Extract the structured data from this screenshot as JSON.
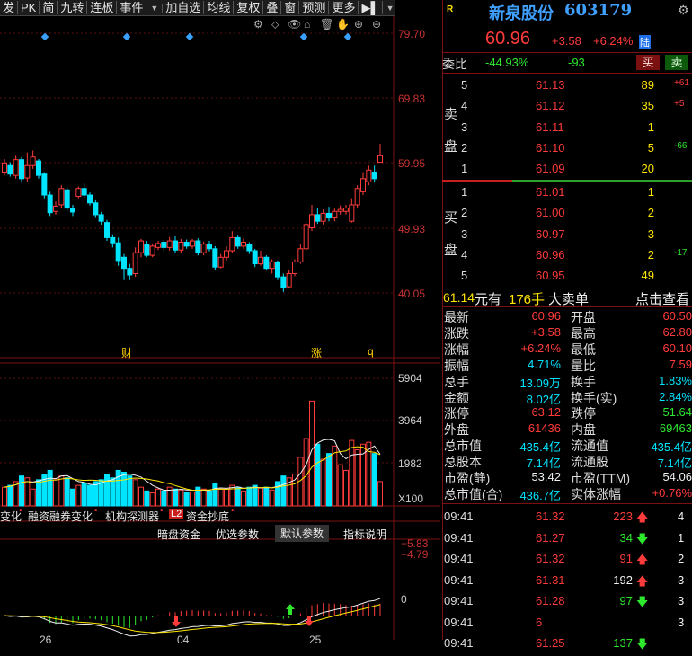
{
  "toolbar": {
    "items": [
      "发",
      "PK",
      "简",
      "九转",
      "连板",
      "事件",
      "▼",
      "加自选",
      "均线",
      "复权",
      "叠",
      "窗",
      "预测",
      "更多",
      "▶▌",
      "▼"
    ]
  },
  "chart": {
    "price_axis": [
      "79.70",
      "69.83",
      "59.95",
      "49.93",
      "40.05"
    ],
    "vol_axis": [
      "5904",
      "3964",
      "1982",
      "X100"
    ],
    "macd_axis": [
      "+5.83",
      "+4.79",
      "0"
    ],
    "event_labels": {
      "cai": "财",
      "zhang": "涨",
      "q": "q"
    },
    "indicator_tabs": [
      "变化",
      "融资融券变化",
      "机构探测器",
      "L2",
      "资金抄底"
    ],
    "param_buttons": [
      "暗盘资金",
      "优选参数",
      "默认参数",
      "指标说明"
    ],
    "date_ticks": [
      "26",
      "04",
      "25"
    ]
  },
  "chart_data": {
    "type": "candlestick",
    "ylim": [
      40.05,
      79.7
    ],
    "candles": [
      {
        "o": 58.5,
        "c": 59.9,
        "h": 60.5,
        "l": 58.0,
        "v": 1000
      },
      {
        "o": 59.5,
        "c": 58.2,
        "h": 60.0,
        "l": 57.8,
        "v": 1100
      },
      {
        "o": 58.0,
        "c": 60.4,
        "h": 61.0,
        "l": 57.5,
        "v": 1300
      },
      {
        "o": 60.4,
        "c": 57.5,
        "h": 60.8,
        "l": 57.0,
        "v": 1600
      },
      {
        "o": 57.6,
        "c": 59.5,
        "h": 61.5,
        "l": 57.0,
        "v": 1500
      },
      {
        "o": 59.5,
        "c": 60.8,
        "h": 61.8,
        "l": 59.0,
        "v": 900
      },
      {
        "o": 60.2,
        "c": 58.0,
        "h": 60.5,
        "l": 57.5,
        "v": 1400
      },
      {
        "o": 58.2,
        "c": 55.0,
        "h": 58.5,
        "l": 54.5,
        "v": 1700
      },
      {
        "o": 55.0,
        "c": 52.3,
        "h": 55.5,
        "l": 51.8,
        "v": 1900
      },
      {
        "o": 52.5,
        "c": 53.3,
        "h": 54.0,
        "l": 52.0,
        "v": 1400
      },
      {
        "o": 53.5,
        "c": 56.0,
        "h": 56.5,
        "l": 53.0,
        "v": 1600
      },
      {
        "o": 55.8,
        "c": 53.0,
        "h": 56.2,
        "l": 52.5,
        "v": 1500
      },
      {
        "o": 53.0,
        "c": 52.4,
        "h": 53.5,
        "l": 51.8,
        "v": 900
      },
      {
        "o": 54.8,
        "c": 56.0,
        "h": 56.3,
        "l": 54.5,
        "v": 1100
      },
      {
        "o": 56.0,
        "c": 55.0,
        "h": 56.8,
        "l": 54.6,
        "v": 1200
      },
      {
        "o": 55.0,
        "c": 53.8,
        "h": 55.4,
        "l": 53.4,
        "v": 1100
      },
      {
        "o": 53.8,
        "c": 52.0,
        "h": 54.2,
        "l": 51.5,
        "v": 1300
      },
      {
        "o": 52.0,
        "c": 51.0,
        "h": 52.4,
        "l": 50.5,
        "v": 1400
      },
      {
        "o": 50.8,
        "c": 48.5,
        "h": 51.2,
        "l": 48.0,
        "v": 1700
      },
      {
        "o": 48.5,
        "c": 47.7,
        "h": 49.0,
        "l": 47.0,
        "v": 1500
      },
      {
        "o": 47.7,
        "c": 45.0,
        "h": 48.5,
        "l": 44.2,
        "v": 1900
      },
      {
        "o": 45.5,
        "c": 43.8,
        "h": 46.0,
        "l": 42.0,
        "v": 1800
      },
      {
        "o": 43.8,
        "c": 42.8,
        "h": 44.5,
        "l": 42.0,
        "v": 1600
      },
      {
        "o": 43.0,
        "c": 46.2,
        "h": 47.0,
        "l": 42.5,
        "v": 1400
      },
      {
        "o": 46.2,
        "c": 48.0,
        "h": 48.3,
        "l": 45.5,
        "v": 1000
      },
      {
        "o": 47.5,
        "c": 45.8,
        "h": 48.0,
        "l": 45.5,
        "v": 800
      },
      {
        "o": 45.8,
        "c": 47.2,
        "h": 47.6,
        "l": 45.5,
        "v": 700
      },
      {
        "o": 47.0,
        "c": 47.6,
        "h": 48.0,
        "l": 46.6,
        "v": 900
      },
      {
        "o": 47.8,
        "c": 47.0,
        "h": 48.2,
        "l": 46.5,
        "v": 800
      },
      {
        "o": 47.0,
        "c": 48.0,
        "h": 48.6,
        "l": 46.5,
        "v": 1000
      },
      {
        "o": 48.0,
        "c": 46.6,
        "h": 48.7,
        "l": 46.2,
        "v": 900
      },
      {
        "o": 46.6,
        "c": 47.8,
        "h": 48.3,
        "l": 46.2,
        "v": 850
      },
      {
        "o": 47.8,
        "c": 47.2,
        "h": 48.2,
        "l": 46.8,
        "v": 700
      },
      {
        "o": 47.2,
        "c": 48.0,
        "h": 48.3,
        "l": 46.8,
        "v": 750
      },
      {
        "o": 48.0,
        "c": 46.2,
        "h": 48.4,
        "l": 45.8,
        "v": 1000
      },
      {
        "o": 46.2,
        "c": 47.5,
        "h": 47.9,
        "l": 45.8,
        "v": 900
      },
      {
        "o": 47.5,
        "c": 46.8,
        "h": 48.0,
        "l": 46.4,
        "v": 800
      },
      {
        "o": 46.8,
        "c": 44.0,
        "h": 47.2,
        "l": 43.5,
        "v": 1200
      },
      {
        "o": 44.0,
        "c": 45.5,
        "h": 46.0,
        "l": 43.8,
        "v": 900
      },
      {
        "o": 45.5,
        "c": 46.5,
        "h": 47.2,
        "l": 45.0,
        "v": 900
      },
      {
        "o": 46.5,
        "c": 48.5,
        "h": 49.5,
        "l": 46.2,
        "v": 1100
      },
      {
        "o": 48.5,
        "c": 47.2,
        "h": 48.8,
        "l": 46.8,
        "v": 1000
      },
      {
        "o": 47.2,
        "c": 47.8,
        "h": 48.4,
        "l": 46.8,
        "v": 800
      },
      {
        "o": 47.5,
        "c": 46.5,
        "h": 47.8,
        "l": 46.0,
        "v": 1000
      },
      {
        "o": 46.5,
        "c": 44.5,
        "h": 46.8,
        "l": 44.0,
        "v": 1100
      },
      {
        "o": 44.5,
        "c": 45.5,
        "h": 46.5,
        "l": 44.2,
        "v": 950
      },
      {
        "o": 45.5,
        "c": 43.8,
        "h": 45.8,
        "l": 43.5,
        "v": 1000
      },
      {
        "o": 43.8,
        "c": 44.8,
        "h": 45.2,
        "l": 43.0,
        "v": 850
      },
      {
        "o": 44.8,
        "c": 42.5,
        "h": 45.0,
        "l": 42.0,
        "v": 1300
      },
      {
        "o": 42.5,
        "c": 40.8,
        "h": 43.0,
        "l": 40.2,
        "v": 1600
      },
      {
        "o": 41.0,
        "c": 43.0,
        "h": 43.5,
        "l": 40.8,
        "v": 1500
      },
      {
        "o": 43.0,
        "c": 44.8,
        "h": 45.2,
        "l": 42.6,
        "v": 1700
      },
      {
        "o": 44.8,
        "c": 46.8,
        "h": 47.5,
        "l": 44.5,
        "v": 2600
      },
      {
        "o": 46.8,
        "c": 50.5,
        "h": 51.0,
        "l": 46.5,
        "v": 3600
      },
      {
        "o": 50.0,
        "c": 52.0,
        "h": 53.5,
        "l": 49.5,
        "v": 5600
      },
      {
        "o": 52.0,
        "c": 51.0,
        "h": 53.0,
        "l": 50.6,
        "v": 3300
      },
      {
        "o": 51.0,
        "c": 52.2,
        "h": 52.8,
        "l": 50.5,
        "v": 2500
      },
      {
        "o": 52.2,
        "c": 51.5,
        "h": 53.2,
        "l": 51.0,
        "v": 2800
      },
      {
        "o": 51.5,
        "c": 52.5,
        "h": 53.0,
        "l": 51.0,
        "v": 3200
      },
      {
        "o": 52.5,
        "c": 52.8,
        "h": 53.4,
        "l": 52.0,
        "v": 2200
      },
      {
        "o": 52.5,
        "c": 53.0,
        "h": 53.5,
        "l": 52.0,
        "v": 1900
      },
      {
        "o": 51.0,
        "c": 53.5,
        "h": 54.5,
        "l": 50.8,
        "v": 3500
      },
      {
        "o": 53.5,
        "c": 56.0,
        "h": 56.5,
        "l": 53.0,
        "v": 3000
      },
      {
        "o": 55.5,
        "c": 57.5,
        "h": 58.5,
        "l": 55.0,
        "v": 3300
      },
      {
        "o": 57.0,
        "c": 58.8,
        "h": 59.5,
        "l": 56.5,
        "v": 3400
      },
      {
        "o": 58.5,
        "c": 57.5,
        "h": 59.5,
        "l": 57.0,
        "v": 2800
      },
      {
        "o": 60.0,
        "c": 61.0,
        "h": 62.8,
        "l": 60.1,
        "v": 1300
      }
    ],
    "volume_ylim": [
      0,
      5904
    ],
    "macd_ylim": [
      -1.5,
      5.83
    ]
  },
  "quote": {
    "badge": "R",
    "name": "新泉股份",
    "code": "603179",
    "price": "60.96",
    "change": "+3.58",
    "change_pct": "+6.24%",
    "market": "陆",
    "weibi_label": "委比",
    "weibi_pct": "-44.93%",
    "weibi_diff": "-93",
    "buy_btn": "买",
    "sell_btn": "卖",
    "sell_side_label": [
      "卖",
      "盘"
    ],
    "buy_side_label": [
      "买",
      "盘"
    ],
    "asks": [
      {
        "lvl": "5",
        "price": "61.13",
        "vol": "89",
        "chg": "+61"
      },
      {
        "lvl": "4",
        "price": "61.12",
        "vol": "35",
        "chg": "+5"
      },
      {
        "lvl": "3",
        "price": "61.11",
        "vol": "1",
        "chg": ""
      },
      {
        "lvl": "2",
        "price": "61.10",
        "vol": "5",
        "chg": "-66"
      },
      {
        "lvl": "1",
        "price": "61.09",
        "vol": "20",
        "chg": ""
      }
    ],
    "bids": [
      {
        "lvl": "1",
        "price": "61.01",
        "vol": "1",
        "chg": ""
      },
      {
        "lvl": "2",
        "price": "61.00",
        "vol": "2",
        "chg": ""
      },
      {
        "lvl": "3",
        "price": "60.97",
        "vol": "3",
        "chg": ""
      },
      {
        "lvl": "4",
        "price": "60.96",
        "vol": "2",
        "chg": "-17"
      },
      {
        "lvl": "5",
        "price": "60.95",
        "vol": "49",
        "chg": ""
      }
    ],
    "big_order": {
      "price": "61.14",
      "unit": "元有",
      "qty": "176手",
      "label": "大卖单",
      "link": "点击查看"
    },
    "stats": [
      [
        "最新",
        "60.96",
        "开盘",
        "60.50"
      ],
      [
        "涨跌",
        "+3.58",
        "最高",
        "62.80"
      ],
      [
        "涨幅",
        "+6.24%",
        "最低",
        "60.10"
      ],
      [
        "振幅",
        "4.71%",
        "量比",
        "7.59"
      ],
      [
        "总手",
        "13.09万",
        "换手",
        "1.83%"
      ],
      [
        "金额",
        "8.02亿",
        "换手(实)",
        "2.84%"
      ],
      [
        "涨停",
        "63.12",
        "跌停",
        "51.64"
      ],
      [
        "外盘",
        "61436",
        "内盘",
        "69463"
      ],
      [
        "总市值",
        "435.4亿",
        "流通值",
        "435.4亿"
      ],
      [
        "总股本",
        "7.14亿",
        "流通股",
        "7.14亿"
      ],
      [
        "市盈(静)",
        "53.42",
        "市盈(TTM)",
        "54.06"
      ],
      [
        "总市值(合)",
        "436.7亿",
        "实体涨幅",
        "+0.76%"
      ]
    ],
    "ticks": [
      {
        "time": "09:41",
        "price": "61.32",
        "vol": "223",
        "dir": "up",
        "extra": "4"
      },
      {
        "time": "09:41",
        "price": "61.27",
        "vol": "34",
        "dir": "down",
        "extra": "1"
      },
      {
        "time": "09:41",
        "price": "61.32",
        "vol": "91",
        "dir": "up",
        "extra": "2"
      },
      {
        "time": "09:41",
        "price": "61.31",
        "vol": "192",
        "dir": "up",
        "extra": "3"
      },
      {
        "time": "09:41",
        "price": "61.28",
        "vol": "97",
        "dir": "down",
        "extra": "3"
      },
      {
        "time": "09:41",
        "price": "6",
        "vol": "",
        "dir": "",
        "extra": "3"
      },
      {
        "time": "09:41",
        "price": "61.25",
        "vol": "137",
        "dir": "down",
        "extra": ""
      }
    ]
  }
}
